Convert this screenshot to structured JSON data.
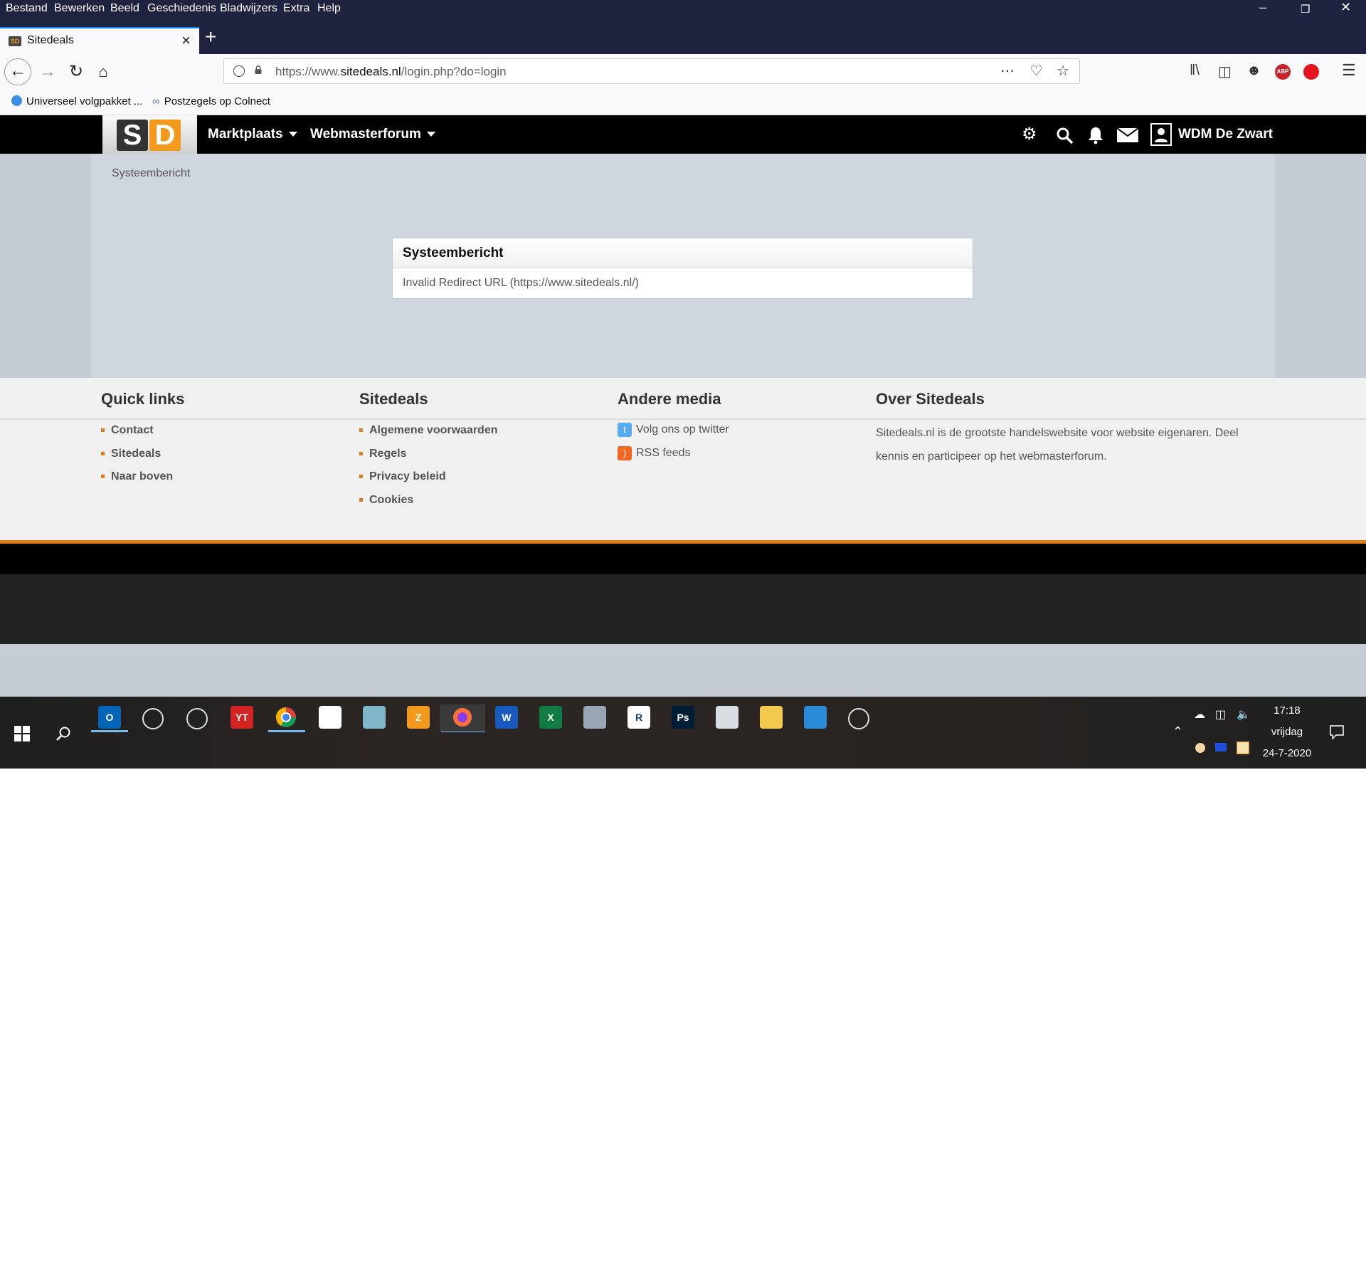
{
  "browser": {
    "menu": [
      "Bestand",
      "Bewerken",
      "Beeld",
      "Geschiedenis",
      "Bladwijzers",
      "Extra",
      "Help"
    ],
    "tab_title": "Sitedeals",
    "tab_favicon": "SD",
    "url_gray_prefix": "https://www.",
    "url_domain": "sitedeals.nl",
    "url_path": "/login.php?do=login",
    "bookmarks": [
      "Universeel volgpakket ...",
      "Postzegels op Colnect"
    ],
    "addon_abp": "ABP"
  },
  "site": {
    "logo_s": "S",
    "logo_d": "D",
    "nav": [
      "Marktplaats",
      "Webmasterforum"
    ],
    "user": "WDM De Zwart",
    "breadcrumb": "Systeembericht",
    "message": {
      "title": "Systeembericht",
      "text": "Invalid Redirect URL (https://www.sitedeals.nl/)"
    },
    "footer": {
      "headings": [
        "Quick links",
        "Sitedeals",
        "Andere media",
        "Over Sitedeals"
      ],
      "quick_links": [
        "Contact",
        "Sitedeals",
        "Naar boven"
      ],
      "sitedeals_links": [
        "Algemene voorwaarden",
        "Regels",
        "Privacy beleid",
        "Cookies"
      ],
      "media": [
        "Volg ons op twitter",
        "RSS feeds"
      ],
      "about": "Sitedeals.nl is de grootste handelswebsite voor website eigenaren. Deel kennis en participeer op het webmasterforum."
    }
  },
  "taskbar": {
    "time": "17:18",
    "day": "vrijdag",
    "date": "24-7-2020",
    "apps": [
      {
        "label": "O",
        "color": "#0364b8"
      },
      {
        "label": "",
        "color": "transparent"
      },
      {
        "label": "",
        "color": "transparent"
      },
      {
        "label": "YT",
        "color": "#d32323"
      },
      {
        "label": "",
        "color": "transparent"
      },
      {
        "label": "",
        "color": "#ffffff"
      },
      {
        "label": "",
        "color": "#7fb6c8"
      },
      {
        "label": "Z",
        "color": "#f39a1c"
      },
      {
        "label": "",
        "color": "transparent"
      },
      {
        "label": "W",
        "color": "#185abd"
      },
      {
        "label": "X",
        "color": "#107c41"
      },
      {
        "label": "",
        "color": "#9aa6b3"
      },
      {
        "label": "R",
        "color": "#ffffff"
      },
      {
        "label": "Ps",
        "color": "#001e36"
      },
      {
        "label": "",
        "color": "#d9dde2"
      },
      {
        "label": "",
        "color": "#f2c94c"
      },
      {
        "label": "",
        "color": "#2a8bd8"
      },
      {
        "label": "",
        "color": "transparent"
      }
    ]
  }
}
